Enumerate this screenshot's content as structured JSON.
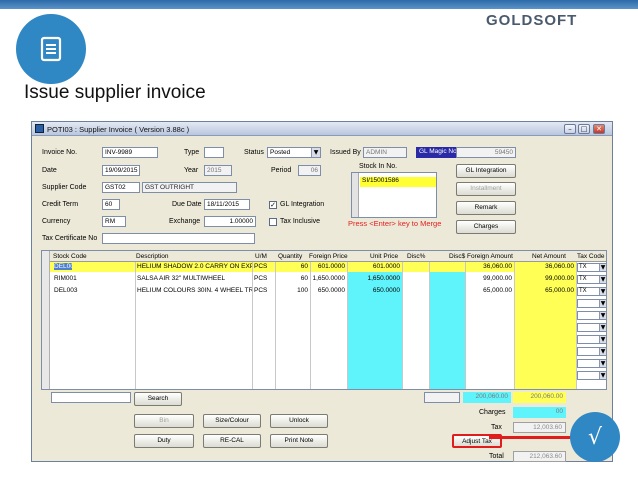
{
  "slide": {
    "logo": "GOLDSOFT",
    "title": "Issue supplier invoice",
    "check_glyph": "√"
  },
  "window": {
    "title": "POTI03 : Supplier Invoice ( Version 3.88c )",
    "controls": {
      "minimize": "–",
      "restore": "□",
      "close": "✕"
    }
  },
  "form": {
    "invoice_no_label": "Invoice No.",
    "invoice_no": "INV-9989",
    "type_label": "Type",
    "type": "",
    "status_label": "Status",
    "status": "Posted",
    "issued_by_label": "Issued By",
    "issued_by": "ADMIN",
    "gl_magic_label": "GL Magic No.",
    "gl_magic_no": "59450",
    "date_label": "Date",
    "date": "19/09/2015",
    "year_label": "Year",
    "year": "2015",
    "period_label": "Period",
    "period": "06",
    "supplier_code_label": "Supplier Code",
    "supplier_code": "GST02",
    "supplier_name": "GST OUTRIGHT",
    "credit_term_label": "Credit Term",
    "credit_term": "60",
    "due_date_label": "Due Date",
    "due_date": "18/11/2015",
    "gl_integration_label": "GL Integration",
    "gl_integration_checked": true,
    "currency_label": "Currency",
    "currency": "RM",
    "exchange_label": "Exchange",
    "exchange": "1.00000",
    "tax_inclusive_label": "Tax Inclusive",
    "tax_inclusive_checked": false,
    "tax_cert_label": "Tax Certificate No",
    "tax_cert": "",
    "stock_in_label": "Stock In No.",
    "stock_in_items": [
      "SI/15001586"
    ],
    "merge_hint": "Press <Enter> key to Merge"
  },
  "side_buttons": {
    "gl_integration": "GL Integration",
    "installment": "Installment",
    "remark": "Remark",
    "charges": "Charges"
  },
  "grid": {
    "columns": [
      "Stock Code",
      "Description",
      "U/M",
      "Quantity",
      "Foreign Price",
      "Unit Price",
      "Disc%",
      "Disc$",
      "Foreign Amount",
      "Net Amount",
      "Tax Code"
    ],
    "rows": [
      {
        "stock_code": "DEL005",
        "description": "HELIUM SHADOW 2.0 CARRY ON EXPAN",
        "um": "PCS",
        "qty": "60",
        "foreign_price": "601.0000",
        "unit_price": "601.0000",
        "disc_pct": "",
        "disc_amt": "",
        "foreign_amount": "36,060.00",
        "net_amount": "36,060.00",
        "tax_code": "TX"
      },
      {
        "stock_code": "RIM001",
        "description": "SALSA AIR 32\" MULTIWHEEL",
        "um": "PCS",
        "qty": "60",
        "foreign_price": "1,650.0000",
        "unit_price": "1,650.0000",
        "disc_pct": "",
        "disc_amt": "",
        "foreign_amount": "99,000.00",
        "net_amount": "99,000.00",
        "tax_code": "TX"
      },
      {
        "stock_code": "DEL003",
        "description": "HELIUM COLOURS 30IN. 4 WHEEL TROL",
        "um": "PCS",
        "qty": "100",
        "foreign_price": "650.0000",
        "unit_price": "650.0000",
        "disc_pct": "",
        "disc_amt": "",
        "foreign_amount": "65,000.00",
        "net_amount": "65,000.00",
        "tax_code": "TX"
      }
    ]
  },
  "footer": {
    "search_value": "",
    "search_button": "Search",
    "bin_button": "Bin",
    "size_colour_button": "Size/Colour",
    "unlock_button": "Unlock",
    "duty_button": "Duty",
    "recal_button": "RE-CAL",
    "print_note_button": "Print Note",
    "total_foreign": "200,060.00",
    "total_net": "200,060.00",
    "charges_label": "Charges",
    "charges": "00",
    "tax_label": "Tax",
    "tax": "12,003.60",
    "adjust_tax_button": "Adjust Tax",
    "total_label": "Total",
    "total": "212,063.60"
  }
}
